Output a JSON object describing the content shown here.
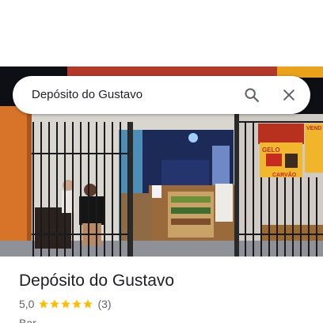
{
  "search": {
    "query": "Depósito do Gustavo",
    "search_icon": "search-icon",
    "close_icon": "close-icon"
  },
  "place": {
    "name": "Depósito do Gustavo",
    "rating": "5,0",
    "stars": 5,
    "review_count": "(3)",
    "category": "Bar"
  },
  "photo": {
    "signs": {
      "gelo": "GELO",
      "carvao": "CARVÃO",
      "vend": "VEND"
    }
  },
  "colors": {
    "star": "#fbbc04",
    "text_primary": "#202124",
    "text_secondary": "#5f6368",
    "icon": "#5f6368"
  }
}
